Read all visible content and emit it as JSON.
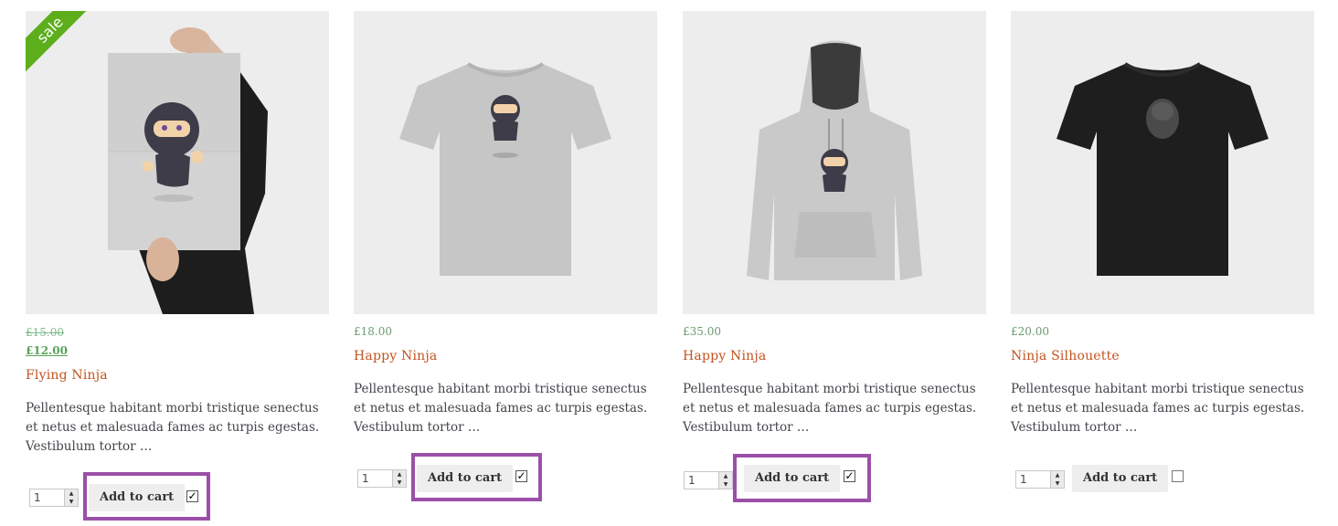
{
  "products": [
    {
      "name": "Flying Ninja",
      "sale_badge": "sale",
      "price_old": "£15.00",
      "price": "£12.00",
      "description": "Pellentesque habitant morbi tristique senectus et netus et malesuada fames ac turpis egestas. Vestibulum tortor …",
      "quantity": "1",
      "button_label": "Add to cart",
      "checked": true,
      "highlighted": true,
      "image": "poster-held-by-hands"
    },
    {
      "name": "Happy Ninja",
      "price": "£18.00",
      "description": "Pellentesque habitant morbi tristique senectus et netus et malesuada fames ac turpis egestas. Vestibulum tortor …",
      "quantity": "1",
      "button_label": "Add to cart",
      "checked": true,
      "highlighted": true,
      "image": "grey-tshirt"
    },
    {
      "name": "Happy Ninja",
      "price": "£35.00",
      "description": "Pellentesque habitant morbi tristique senectus et netus et malesuada fames ac turpis egestas. Vestibulum tortor …",
      "quantity": "1",
      "button_label": "Add to cart",
      "checked": true,
      "highlighted": true,
      "image": "grey-hoodie"
    },
    {
      "name": "Ninja Silhouette",
      "price": "£20.00",
      "description": "Pellentesque habitant morbi tristique senectus et netus et malesuada fames ac turpis egestas. Vestibulum tortor …",
      "quantity": "1",
      "button_label": "Add to cart",
      "checked": false,
      "highlighted": false,
      "image": "black-tshirt"
    }
  ],
  "colors": {
    "sale_badge": "#5cae1b",
    "title": "#c2531f",
    "price": "#6a9a6e",
    "highlight": "#9b4fa8",
    "button_bg": "#eeeeee"
  }
}
